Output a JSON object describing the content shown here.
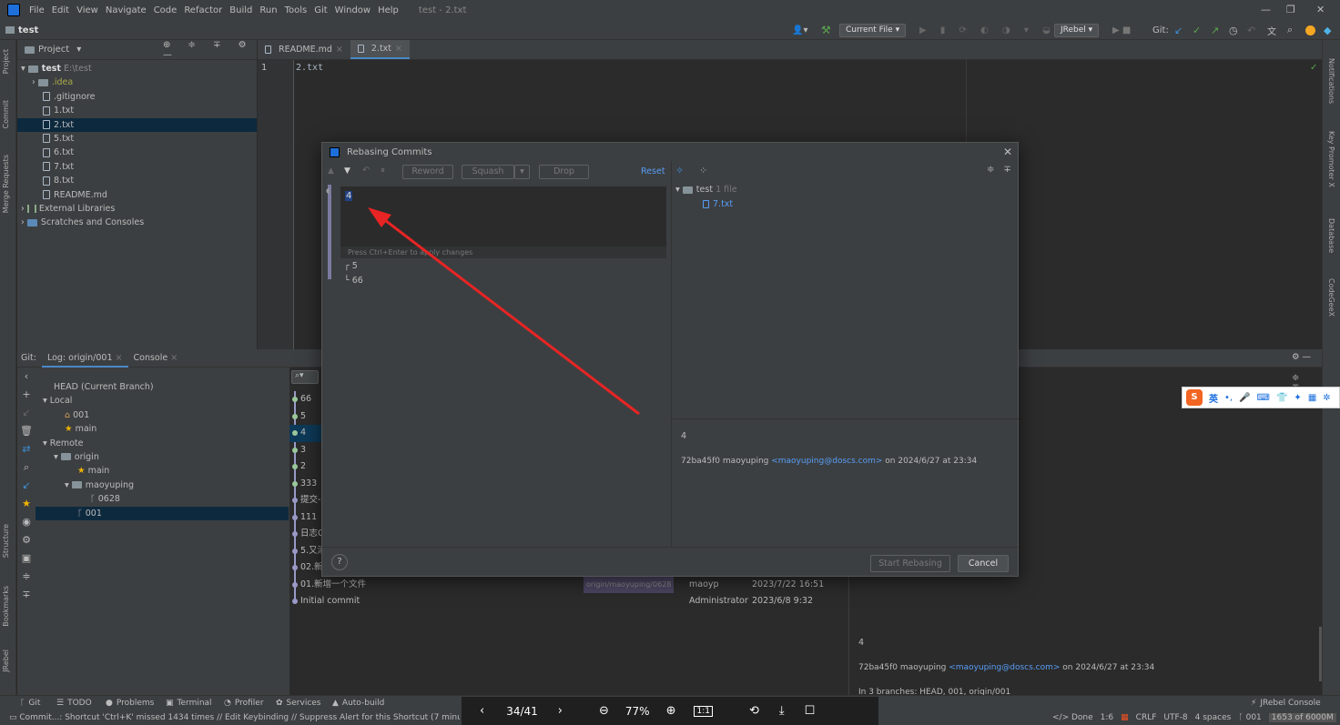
{
  "menu": {
    "items": [
      "File",
      "Edit",
      "View",
      "Navigate",
      "Code",
      "Refactor",
      "Build",
      "Run",
      "Tools",
      "Git",
      "Window",
      "Help"
    ],
    "title": "test - 2.txt"
  },
  "navbar": {
    "project": "test",
    "current_file": "Current File",
    "jrebel": "JRebel",
    "git_label": "Git:"
  },
  "project_panel": {
    "title": "Project",
    "root": "test",
    "root_path": "E:\\test",
    "items": [
      ".idea",
      ".gitignore",
      "1.txt",
      "2.txt",
      "5.txt",
      "6.txt",
      "7.txt",
      "8.txt",
      "README.md",
      "External Libraries",
      "Scratches and Consoles"
    ]
  },
  "editor": {
    "tabs": [
      "README.md",
      "2.txt"
    ],
    "line_number": "1",
    "content": "2.txt"
  },
  "left_strip": {
    "labels": [
      "Project",
      "Commit",
      "Merge Requests",
      "Structure",
      "Bookmarks",
      "JRebel"
    ]
  },
  "right_strip": {
    "labels": [
      "Notifications",
      "Key Promoter X",
      "Database",
      "CodeGeeX"
    ]
  },
  "bottom": {
    "tabs": [
      "Git:",
      "Log: origin/001",
      "Console"
    ],
    "branches": {
      "head": "HEAD (Current Branch)",
      "local": "Local",
      "local_items": [
        "001",
        "main"
      ],
      "remote": "Remote",
      "origin": "origin",
      "origin_items": [
        "main"
      ],
      "maoyuping": "maoyuping",
      "maoyuping_items": [
        "0628"
      ],
      "selected": "001"
    },
    "log_rows": [
      {
        "msg": "66",
        "tag": "",
        "author": "",
        "date": ""
      },
      {
        "msg": "5",
        "tag": "",
        "author": "",
        "date": ""
      },
      {
        "msg": "4",
        "tag": "",
        "author": "",
        "date": ""
      },
      {
        "msg": "3",
        "tag": "",
        "author": "",
        "date": ""
      },
      {
        "msg": "2",
        "tag": "",
        "author": "",
        "date": ""
      },
      {
        "msg": "333",
        "tag": "",
        "author": "",
        "date": ""
      },
      {
        "msg": "提交-",
        "tag": "",
        "author": "",
        "date": ""
      },
      {
        "msg": "111",
        "tag": "",
        "author": "",
        "date": ""
      },
      {
        "msg": "日志C",
        "tag": "",
        "author": "",
        "date": ""
      },
      {
        "msg": "5.又添",
        "tag": "",
        "author": "",
        "date": ""
      },
      {
        "msg": "02.新",
        "tag": "",
        "author": "",
        "date": ""
      },
      {
        "msg": "01.新增一个文件",
        "tag": "origin/maoyuping/0628",
        "author": "maoyp",
        "date": "2023/7/22 16:51"
      },
      {
        "msg": "Initial commit",
        "tag": "",
        "author": "Administrator",
        "date": "2023/6/8 9:32"
      }
    ],
    "details": {
      "subject": "4",
      "hash": "72ba45f0",
      "author": "maoyuping",
      "email": "<maoyuping@doscs.com>",
      "on": "on 2024/6/27 at 23:34",
      "branches": "In 3 branches: HEAD, 001, origin/001"
    }
  },
  "dialog": {
    "title": "Rebasing Commits",
    "buttons": {
      "reword": "Reword",
      "squash": "Squash",
      "drop": "Drop",
      "reset": "Reset"
    },
    "editing": "4",
    "hint": "Press Ctrl+Enter to apply changes",
    "commits": [
      "5",
      "66"
    ],
    "changes_root": "test",
    "changes_count": "1 file",
    "changes_file": "7.txt",
    "detail_subject": "4",
    "detail_hash": "72ba45f0",
    "detail_author": "maoyuping",
    "detail_email": "<maoyuping@doscs.com>",
    "detail_on": "on 2024/6/27 at 23:34",
    "help": "?",
    "start": "Start Rebasing",
    "cancel": "Cancel"
  },
  "statusbar": {
    "tabs": [
      "Git",
      "TODO",
      "Problems",
      "Terminal",
      "Profiler",
      "Services",
      "Auto-build"
    ],
    "jrebel": "JRebel Console",
    "message": "Commit...: Shortcut 'Ctrl+K' missed 1434 times // Edit Keybinding // Suppress Alert for this Shortcut (7 minutes",
    "done": "Done",
    "pos": "1:6",
    "crlf": "CRLF",
    "enc": "UTF-8",
    "indent": "4 spaces",
    "branch": "001",
    "mem": "1653 of 6000M"
  },
  "viewer": {
    "page": "34/41",
    "zoom": "77%",
    "ratio": "1:1"
  },
  "ime": {
    "label": "英"
  }
}
